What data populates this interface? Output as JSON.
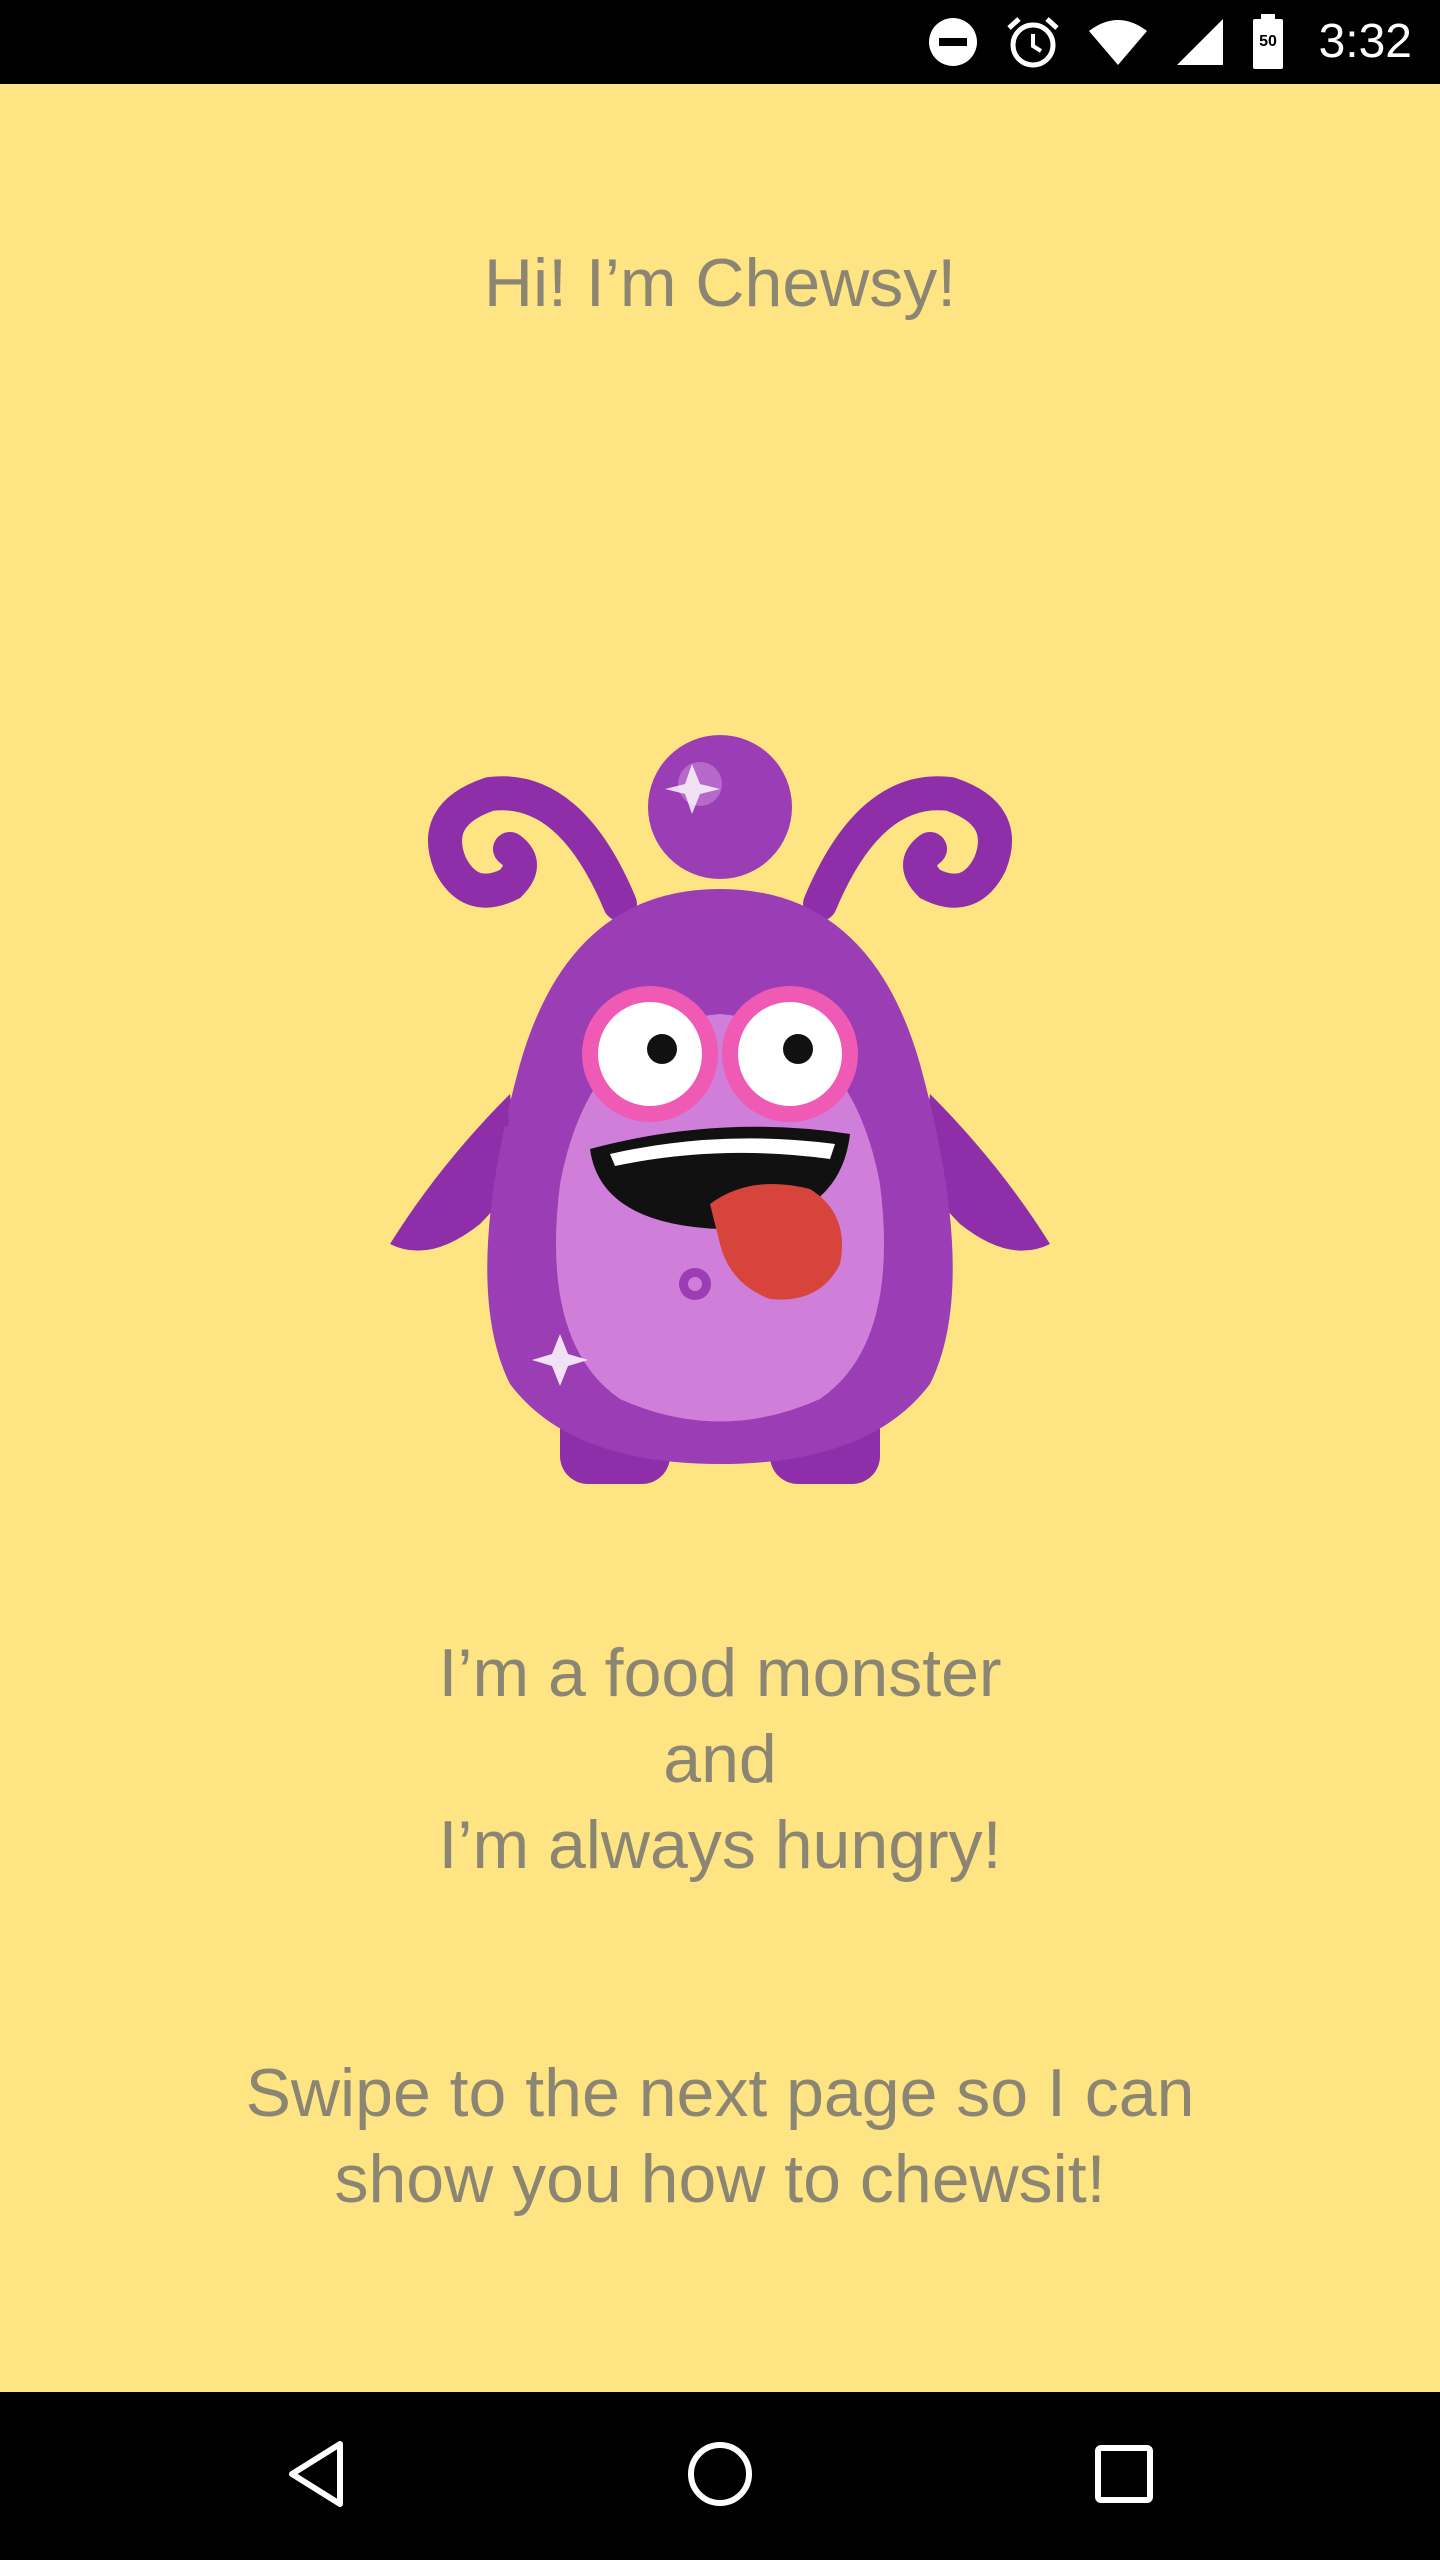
{
  "status_bar": {
    "time": "3:32",
    "battery_level": "50",
    "icons": [
      "do-not-disturb-icon",
      "alarm-icon",
      "wifi-icon",
      "cell-signal-icon",
      "battery-icon"
    ]
  },
  "page": {
    "greeting": "Hi! I’m Chewsy!",
    "intro_lines": [
      "I’m a food monster",
      "and",
      "I’m always hungry!"
    ],
    "swipe_lines": [
      "Swipe to the next page so I can",
      "show you how to chewsit!"
    ],
    "background_color": "#fee482",
    "text_color": "#8b8574"
  },
  "monster": {
    "icon": "chewsy-monster-illustration",
    "body_color": "#9b3db5",
    "belly_color": "#cf7ed9",
    "tongue_color": "#d6443b"
  },
  "nav_bar": {
    "icons": [
      "back-icon",
      "home-icon",
      "recents-icon"
    ]
  }
}
